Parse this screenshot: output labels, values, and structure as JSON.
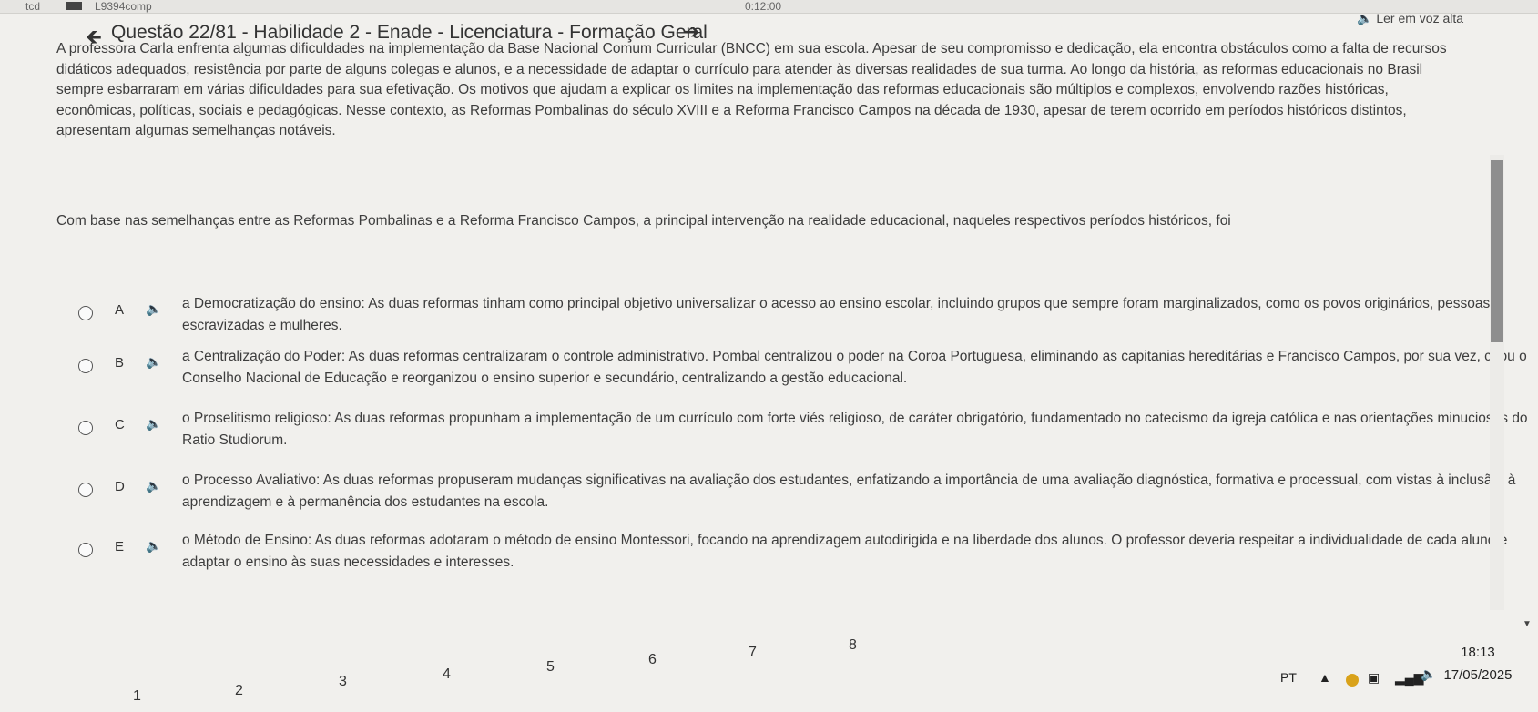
{
  "topbar": {
    "left_text": "tcd",
    "left_text2": "L9394comp",
    "center_time": "0:12:00"
  },
  "header": {
    "title": "Questão 22/81 - Habilidade 2 - Enade - Licenciatura - Formação Geral",
    "tts_label": "Ler em voz alta"
  },
  "question": {
    "paragraph_1": "A professora Carla enfrenta algumas dificuldades na implementação da Base Nacional Comum Curricular (BNCC) em sua escola. Apesar de seu compromisso e dedicação, ela encontra obstáculos como a falta de recursos didáticos adequados, resistência por parte de alguns colegas e alunos, e a necessidade de adaptar o currículo para atender às diversas realidades de sua turma. Ao longo da história, as reformas educacionais no Brasil sempre esbarraram em várias dificuldades para sua efetivação.  Os motivos que ajudam a explicar os limites na implementação das reformas educacionais são múltiplos e complexos, envolvendo razões históricas, econômicas, políticas, sociais e pedagógicas. Nesse contexto, as Reformas Pombalinas do século XVIII e a Reforma Francisco Campos na década de 1930, apesar de terem ocorrido em períodos históricos distintos, apresentam algumas semelhanças notáveis.",
    "paragraph_2": "Com base nas semelhanças entre as Reformas Pombalinas e a Reforma Francisco Campos, a principal intervenção na realidade educacional, naqueles respectivos períodos históricos, foi"
  },
  "options": [
    {
      "letter": "A",
      "text": "a Democratização do ensino: As duas reformas tinham como principal objetivo universalizar o acesso ao ensino escolar, incluindo grupos que sempre foram marginalizados, como os povos originários, pessoas escravizadas e mulheres."
    },
    {
      "letter": "B",
      "text": "a Centralização do Poder: As duas reformas centralizaram o controle administrativo. Pombal centralizou o poder na Coroa Portuguesa, eliminando as capitanias hereditárias e Francisco Campos, por sua vez, criou o Conselho Nacional de Educação e reorganizou o ensino superior e secundário, centralizando a gestão educacional."
    },
    {
      "letter": "C",
      "text": "o Proselitismo religioso: As duas reformas propunham a implementação de um currículo com forte viés religioso, de caráter obrigatório, fundamentado no catecismo da igreja católica e nas orientações minuciosas do Ratio Studiorum."
    },
    {
      "letter": "D",
      "text": "o Processo Avaliativo: As duas reformas propuseram mudanças significativas na avaliação dos estudantes, enfatizando a importância de uma avaliação diagnóstica, formativa e processual, com vistas à inclusão, à aprendizagem e à permanência dos estudantes na escola."
    },
    {
      "letter": "E",
      "text": "o Método de Ensino: As duas reformas adotaram o método de ensino Montessori, focando na aprendizagem autodirigida e na liberdade dos alunos. O professor deveria respeitar a individualidade de cada aluno e adaptar o ensino às suas necessidades e interesses."
    }
  ],
  "pager": [
    "1",
    "2",
    "3",
    "4",
    "5",
    "6",
    "7",
    "8"
  ],
  "taskbar": {
    "lang": "PT",
    "time": "18:13",
    "date": "17/05/2025"
  }
}
